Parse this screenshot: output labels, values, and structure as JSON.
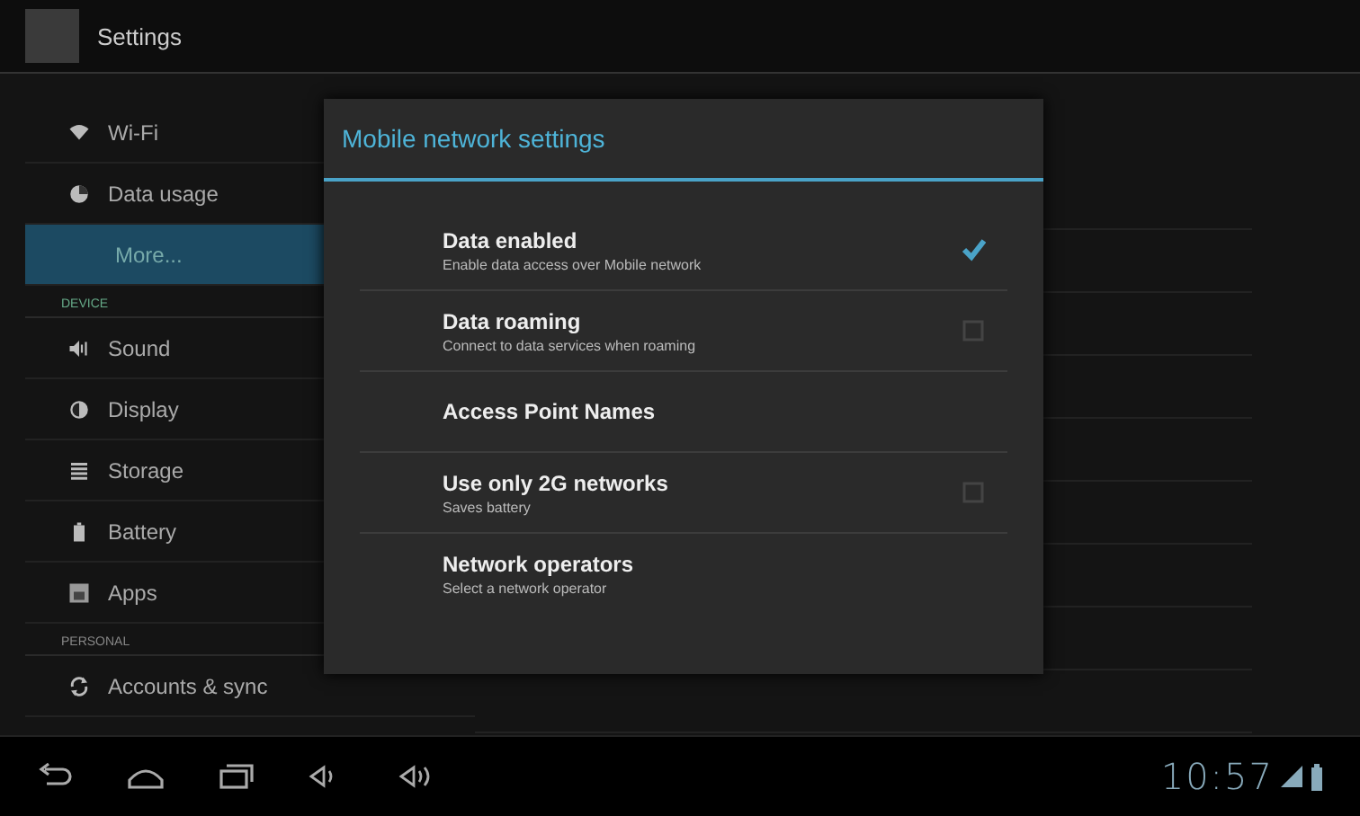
{
  "action_bar": {
    "title": "Settings"
  },
  "sidebar": {
    "items": [
      {
        "kind": "item",
        "label": "Wi-Fi",
        "selected": false
      },
      {
        "kind": "item",
        "label": "Data usage",
        "selected": false
      },
      {
        "kind": "item",
        "label": "More...",
        "selected": true
      },
      {
        "kind": "header",
        "label": "DEVICE"
      },
      {
        "kind": "item",
        "label": "Sound",
        "selected": false
      },
      {
        "kind": "item",
        "label": "Display",
        "selected": false
      },
      {
        "kind": "item",
        "label": "Storage",
        "selected": false
      },
      {
        "kind": "item",
        "label": "Battery",
        "selected": false
      },
      {
        "kind": "item",
        "label": "Apps",
        "selected": false
      },
      {
        "kind": "header",
        "label": "PERSONAL"
      },
      {
        "kind": "item",
        "label": "Accounts & sync",
        "selected": false
      }
    ]
  },
  "dialog": {
    "title": "Mobile network settings",
    "rows": [
      {
        "kind": "checkbox",
        "title": "Data enabled",
        "summary": "Enable data access over Mobile network",
        "checked": true
      },
      {
        "kind": "checkbox",
        "title": "Data roaming",
        "summary": "Connect to data services when roaming",
        "checked": false
      },
      {
        "kind": "plain",
        "title": "Access Point Names"
      },
      {
        "kind": "checkbox",
        "title": "Use only 2G networks",
        "summary": "Saves battery",
        "checked": false
      },
      {
        "kind": "plain",
        "title": "Network operators",
        "summary": "Select a network operator"
      }
    ]
  },
  "system_bar": {
    "time": "10:57"
  }
}
